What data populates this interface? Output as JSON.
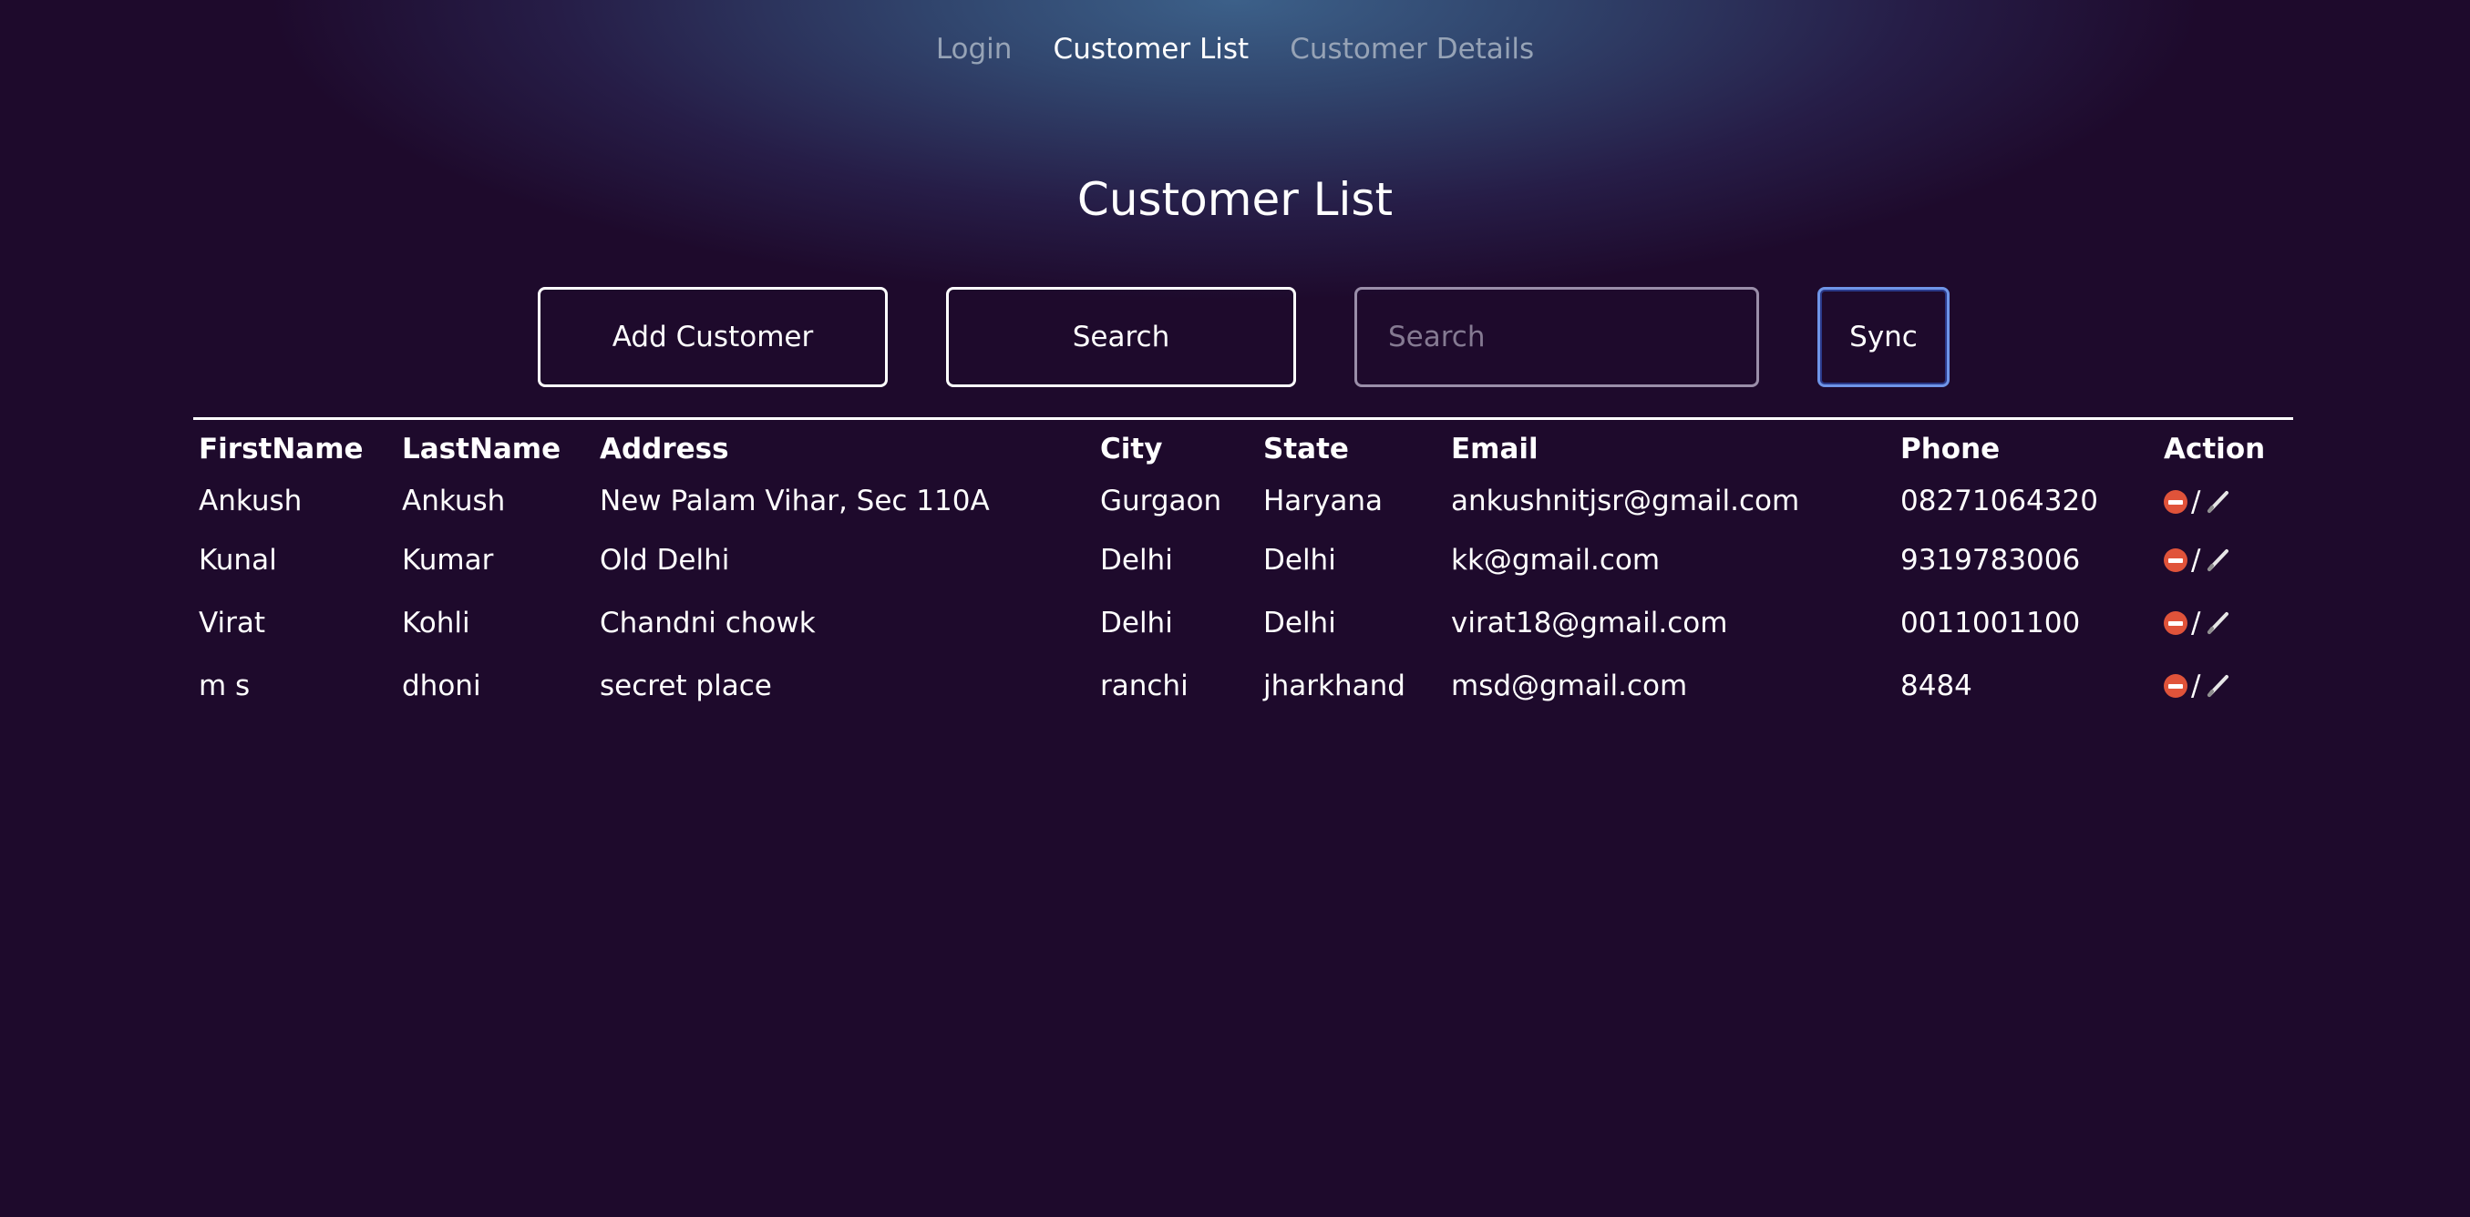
{
  "nav": {
    "links": [
      {
        "label": "Login"
      },
      {
        "label": "Customer List"
      },
      {
        "label": "Customer Details"
      }
    ]
  },
  "page": {
    "title": "Customer List"
  },
  "controls": {
    "add_label": "Add Customer",
    "search_label": "Search",
    "search_placeholder": "Search",
    "search_value": "",
    "sync_label": "Sync"
  },
  "table": {
    "headers": [
      "FirstName",
      "LastName",
      "Address",
      "City",
      "State",
      "Email",
      "Phone",
      "Action"
    ],
    "action_separator": "/",
    "rows": [
      {
        "first": "Ankush",
        "last": "Ankush",
        "address": "New Palam Vihar, Sec 110A",
        "city": "Gurgaon",
        "state": "Haryana",
        "email": "ankushnitjsr@gmail.com",
        "phone": "08271064320"
      },
      {
        "first": "Kunal",
        "last": "Kumar",
        "address": "Old Delhi",
        "city": "Delhi",
        "state": "Delhi",
        "email": "kk@gmail.com",
        "phone": "9319783006"
      },
      {
        "first": "Virat",
        "last": "Kohli",
        "address": "Chandni chowk",
        "city": "Delhi",
        "state": "Delhi",
        "email": "virat18@gmail.com",
        "phone": "0011001100"
      },
      {
        "first": "m s",
        "last": "dhoni",
        "address": "secret place",
        "city": "ranchi",
        "state": "jharkhand",
        "email": "msd@gmail.com",
        "phone": "8484"
      }
    ]
  },
  "icons": {
    "delete": "no-entry-icon",
    "edit": "pen-icon"
  },
  "colors": {
    "background": "#1e0a2c",
    "glow": "#3c6089",
    "nav_inactive": "#96a3b6",
    "sync_border": "#6f95e8",
    "delete_icon": "#e0533a"
  }
}
